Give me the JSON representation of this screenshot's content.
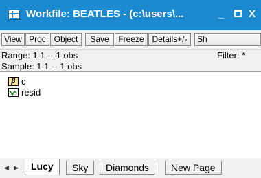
{
  "window": {
    "title": "Workfile: BEATLES - (c:\\users\\...",
    "minimize_glyph": "_",
    "close_glyph": "X"
  },
  "toolbar": {
    "buttons": [
      {
        "label": "View"
      },
      {
        "label": "Proc"
      },
      {
        "label": "Object"
      },
      {
        "label": "Save"
      },
      {
        "label": "Freeze"
      },
      {
        "label": "Details+/-"
      },
      {
        "label": "Sh"
      }
    ]
  },
  "info": {
    "range": "Range:  1 1   --   1 obs",
    "sample": "Sample: 1 1   --   1 obs",
    "filter": "Filter: *"
  },
  "objects": [
    {
      "icon": "coefficient-beta-icon",
      "glyph": "β",
      "name": "c"
    },
    {
      "icon": "series-resid-icon",
      "name": "resid"
    }
  ],
  "tabs": [
    {
      "label": "Lucy",
      "active": true
    },
    {
      "label": "Sky",
      "active": false
    },
    {
      "label": "Diamonds",
      "active": false
    },
    {
      "label": "New Page",
      "active": false
    }
  ],
  "colors": {
    "titlebar": "#1b8ad1",
    "chrome": "#f0f0f0",
    "beta_icon_fill": "#f5e39b"
  }
}
